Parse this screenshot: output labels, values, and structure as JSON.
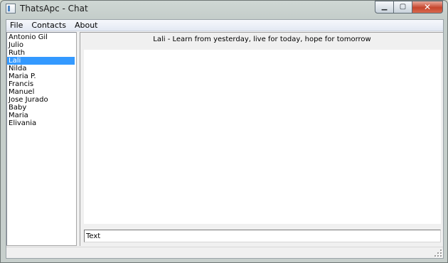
{
  "window": {
    "title": "ThatsApc - Chat",
    "minimize_glyph": "▁",
    "maximize_glyph": "▢",
    "close_glyph": "✕"
  },
  "menu": {
    "items": [
      "File",
      "Contacts",
      "About"
    ]
  },
  "contacts": {
    "items": [
      {
        "name": "Antonio Gil",
        "selected": false
      },
      {
        "name": "Julio",
        "selected": false
      },
      {
        "name": "Ruth",
        "selected": false
      },
      {
        "name": "Lali",
        "selected": true
      },
      {
        "name": "Nilda",
        "selected": false
      },
      {
        "name": "Maria P.",
        "selected": false
      },
      {
        "name": "Francis",
        "selected": false
      },
      {
        "name": "Manuel",
        "selected": false
      },
      {
        "name": "Jose Jurado",
        "selected": false
      },
      {
        "name": "Baby",
        "selected": false
      },
      {
        "name": "Maria",
        "selected": false
      },
      {
        "name": "Elivania",
        "selected": false
      }
    ],
    "selection_color": "#3399ff"
  },
  "chat": {
    "status": "Lali - Learn from yesterday, live for today, hope for tomorrow",
    "input_value": "Text"
  }
}
